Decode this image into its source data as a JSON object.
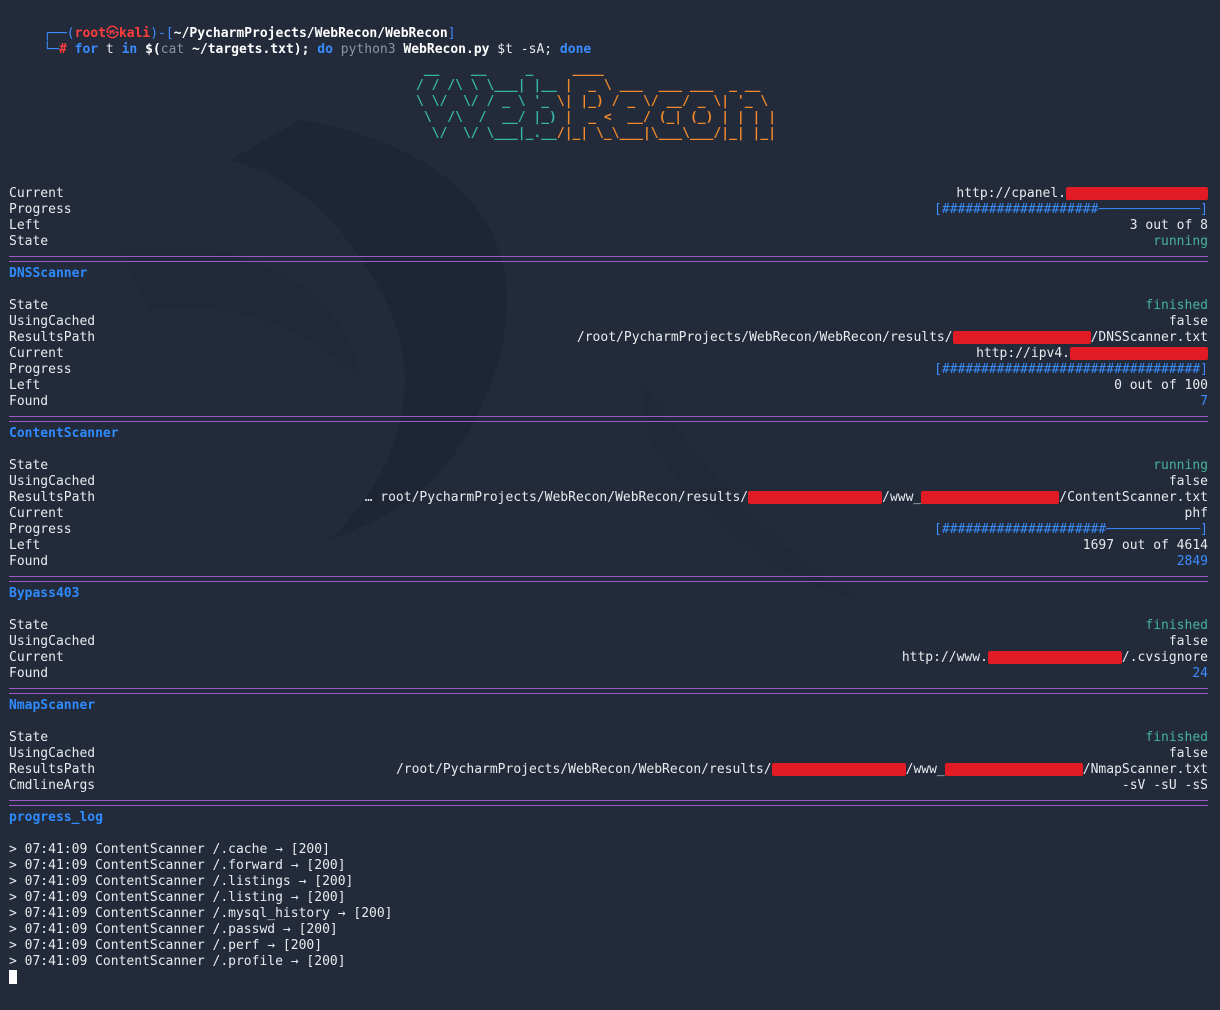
{
  "prompt": {
    "corner_top": "┌──(",
    "user": "root",
    "at": "㉿",
    "host": "kali",
    "mid": ")-[",
    "path": "~/PycharmProjects/WebRecon/WebRecon",
    "close": "]",
    "corner_bottom": "└─",
    "hash": "#",
    "cmd_for": "for",
    "cmd_t": " t ",
    "cmd_in": "in",
    "cmd_sub_open": " $(",
    "cmd_cat": "cat",
    "cmd_file": " ~/targets.txt",
    "cmd_sub_close": ");",
    "cmd_do": " do",
    "cmd_python": " python3",
    "cmd_script": " WebRecon.py",
    "cmd_args": " $t -sA;",
    "cmd_done": " done"
  },
  "banner": {
    "row1": " __    __     _     ____                      ",
    "row2": "/ / /\\ \\ \\___| |__ |  _ \\ ___  ___ ___  _ __  ",
    "row3": "\\ \\/  \\/ / _ \\ '_ \\| |_) / _ \\/ __/ _ \\| '_ \\ ",
    "row4": " \\  /\\  /  __/ |_) |  _ <  __/ (_| (_) | | | |",
    "row5": "  \\/  \\/ \\___|_.__/|_| \\_\\___|\\___\\___/|_| |_|"
  },
  "summary": {
    "current_label": "Current",
    "current_value": "http://cpanel.",
    "progress_label": "Progress",
    "progress_fill": "####################",
    "progress_empty": "─────────────",
    "progress_fraction": 0.375,
    "left_label": "Left",
    "left_value": "3 out of 8",
    "state_label": "State",
    "state_value": "running"
  },
  "dns": {
    "title": "DNSScanner",
    "state_label": "State",
    "state_value": "finished",
    "cached_label": "UsingCached",
    "cached_value": "false",
    "results_label": "ResultsPath",
    "results_prefix": "/root/PycharmProjects/WebRecon/WebRecon/results/",
    "results_suffix": "/DNSScanner.txt",
    "current_label": "Current",
    "current_value": "http://ipv4.",
    "progress_label": "Progress",
    "progress_fill": "#################################",
    "progress_empty": "",
    "progress_fraction": 1.0,
    "left_label": "Left",
    "left_value": "0 out of 100",
    "found_label": "Found",
    "found_value": "7"
  },
  "content": {
    "title": "ContentScanner",
    "state_label": "State",
    "state_value": "running",
    "cached_label": "UsingCached",
    "cached_value": "false",
    "results_label": "ResultsPath",
    "results_prefix": "… root/PycharmProjects/WebRecon/WebRecon/results/",
    "results_mid": "/www_",
    "results_suffix": "/ContentScanner.txt",
    "current_label": "Current",
    "current_value": "phf",
    "progress_label": "Progress",
    "progress_fill": "#####################",
    "progress_empty": "────────────",
    "progress_fraction": 0.368,
    "left_label": "Left",
    "left_value": "1697 out of 4614",
    "found_label": "Found",
    "found_value": "2849"
  },
  "bypass": {
    "title": "Bypass403",
    "state_label": "State",
    "state_value": "finished",
    "cached_label": "UsingCached",
    "cached_value": "false",
    "current_label": "Current",
    "current_prefix": "http://www.",
    "current_suffix": "/.cvsignore",
    "found_label": "Found",
    "found_value": "24"
  },
  "nmap": {
    "title": "NmapScanner",
    "state_label": "State",
    "state_value": "finished",
    "cached_label": "UsingCached",
    "cached_value": "false",
    "results_label": "ResultsPath",
    "results_prefix": "/root/PycharmProjects/WebRecon/WebRecon/results/",
    "results_mid": "/www_",
    "results_suffix": "/NmapScanner.txt",
    "args_label": "CmdlineArgs",
    "args_value": "-sV -sU -sS"
  },
  "progress_log": {
    "title": "progress_log",
    "entries": [
      "> 07:41:09 ContentScanner /.cache → [200]",
      "> 07:41:09 ContentScanner /.forward → [200]",
      "> 07:41:09 ContentScanner /.listings → [200]",
      "> 07:41:09 ContentScanner /.listing → [200]",
      "> 07:41:09 ContentScanner /.mysql_history → [200]",
      "> 07:41:09 ContentScanner /.passwd → [200]",
      "> 07:41:09 ContentScanner /.perf → [200]",
      "> 07:41:09 ContentScanner /.profile → [200]"
    ]
  },
  "colors": {
    "background": "#232b3a",
    "section_title": "#2e8bff",
    "separator": "#9b59c9",
    "state_ok": "#45b39c",
    "numbers": "#3a8cff",
    "redaction": "#e01b24",
    "banner_teal": "#35b5a8",
    "banner_orange": "#f08a2a"
  }
}
